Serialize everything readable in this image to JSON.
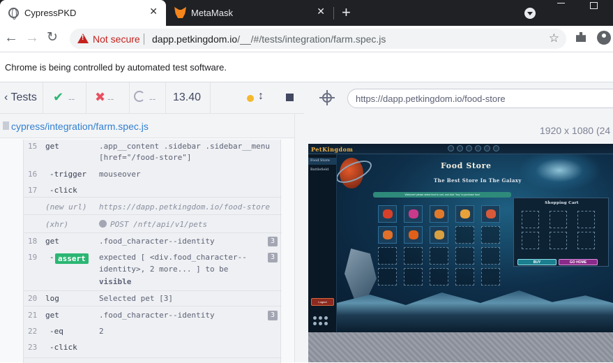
{
  "browser": {
    "tabs": [
      {
        "title": "CypressPKD",
        "active": true
      },
      {
        "title": "MetaMask",
        "active": false
      }
    ],
    "new_tab": "+",
    "close_glyph": "✕",
    "security_label": "Not secure",
    "url_host": "dapp.petkingdom.io",
    "url_path": "/__/#/tests/integration/farm.spec.js",
    "icons": [
      "globe-icon",
      "metamask-fox-icon",
      "back-arrow-icon",
      "forward-arrow-icon",
      "reload-icon",
      "warning-icon",
      "star-icon",
      "extensions-icon",
      "profile-icon"
    ]
  },
  "infobar": {
    "text": "Chrome is being controlled by automated test software."
  },
  "reporter": {
    "tests_label": "Tests",
    "passed": "--",
    "failed": "--",
    "pending": "--",
    "duration": "13.40",
    "spec_path": "cypress/integration/farm.spec.js",
    "accent_color": "#3380d0",
    "commands": [
      {
        "num": "15",
        "name": "get",
        "msg": ".app__content .sidebar .sidebar__menu",
        "msg2": "[href=\"/food-store\"]"
      },
      {
        "num": "16",
        "name": "-trigger",
        "msg": "mouseover"
      },
      {
        "num": "17",
        "name": "-click",
        "msg": ""
      },
      {
        "num": "",
        "name": "(new url)",
        "msg": "https://dapp.petkingdom.io/food-store"
      },
      {
        "num": "",
        "name": "(xhr)",
        "msg": "POST /nft/api/v1/pets"
      },
      {
        "num": "18",
        "name": "get",
        "msg": ".food_character--identity",
        "badge": "3"
      },
      {
        "num": "19",
        "name": "-assert",
        "msg": "expected [ <div.food_character--",
        "msg2": "identity>, 2 more... ] to be",
        "msg3": "visible",
        "badge": "3"
      },
      {
        "num": "20",
        "name": "log",
        "msg": "Selected pet [3]"
      },
      {
        "num": "21",
        "name": "get",
        "msg": ".food_character--identity",
        "badge": "3"
      },
      {
        "num": "22",
        "name": "-eq",
        "msg": "2"
      },
      {
        "num": "23",
        "name": "-click",
        "msg": ""
      }
    ]
  },
  "preview": {
    "url": "https://dapp.petkingdom.io/food-store",
    "viewport": "1920 x 1080  (24",
    "app": {
      "logo": "PetKingdom",
      "sidebar": [
        "Food Store",
        "Battlefield"
      ],
      "logout": "Logout",
      "title": "Food Store",
      "subtitle": "The Best Store In The Galaxy",
      "banner": "Welcome! please select food to cart, and click \"buy\" to purchase food",
      "cart_title": "Shopping Cart",
      "buy": "BUY",
      "go_home": "GO HOME",
      "food_colors": [
        "#d9402a",
        "#c93a8a",
        "#e07a2a",
        "#e8a23a",
        "#d95a3a",
        "#e0702a",
        "#e0601a",
        "#d8a040"
      ]
    }
  }
}
